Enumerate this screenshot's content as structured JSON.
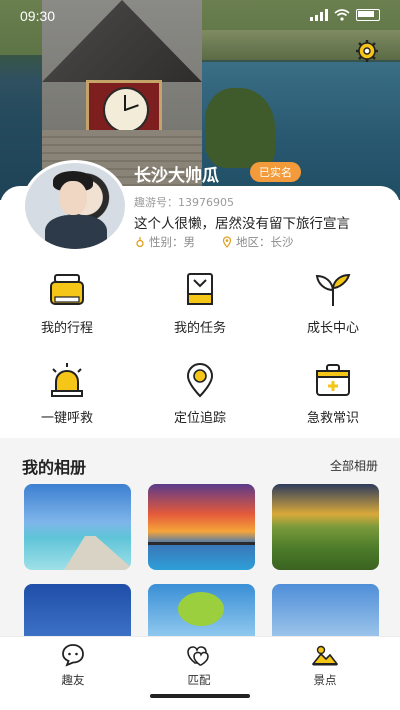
{
  "status_bar": {
    "time": "09:30"
  },
  "profile": {
    "name": "长沙大帅瓜",
    "verified_badge": "已实名",
    "id_line": "趣游号：13976905",
    "motto": "这个人很懒，居然没有留下旅行宣言",
    "gender": "性别：男",
    "region": "地区：长沙"
  },
  "menu": [
    {
      "label": "我的行程",
      "icon": "suitcase-icon"
    },
    {
      "label": "我的任务",
      "icon": "task-icon"
    },
    {
      "label": "成长中心",
      "icon": "sprout-icon"
    },
    {
      "label": "一键呼救",
      "icon": "alarm-icon"
    },
    {
      "label": "定位追踪",
      "icon": "location-icon"
    },
    {
      "label": "急救常识",
      "icon": "first-aid-icon"
    }
  ],
  "album": {
    "title": "我的相册",
    "all_link": "全部相册"
  },
  "tabs": [
    {
      "label": "趣友",
      "icon": "chat-icon"
    },
    {
      "label": "匹配",
      "icon": "heart-icon"
    },
    {
      "label": "景点",
      "icon": "scenery-icon"
    }
  ],
  "colors": {
    "accent": "#f5c518",
    "badge": "#f39b3a"
  }
}
